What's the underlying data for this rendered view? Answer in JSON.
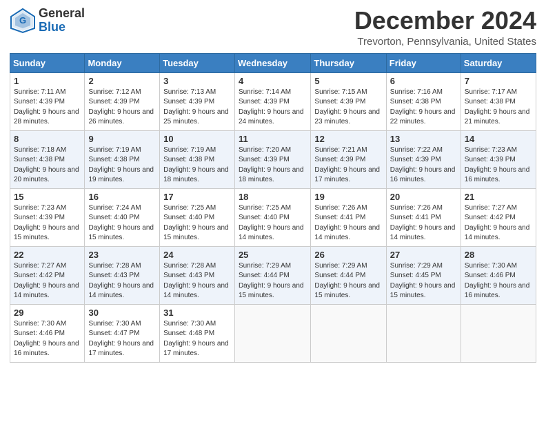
{
  "header": {
    "logo_general": "General",
    "logo_blue": "Blue",
    "month": "December 2024",
    "location": "Trevorton, Pennsylvania, United States"
  },
  "weekdays": [
    "Sunday",
    "Monday",
    "Tuesday",
    "Wednesday",
    "Thursday",
    "Friday",
    "Saturday"
  ],
  "weeks": [
    [
      {
        "day": "1",
        "sunrise": "Sunrise: 7:11 AM",
        "sunset": "Sunset: 4:39 PM",
        "daylight": "Daylight: 9 hours and 28 minutes."
      },
      {
        "day": "2",
        "sunrise": "Sunrise: 7:12 AM",
        "sunset": "Sunset: 4:39 PM",
        "daylight": "Daylight: 9 hours and 26 minutes."
      },
      {
        "day": "3",
        "sunrise": "Sunrise: 7:13 AM",
        "sunset": "Sunset: 4:39 PM",
        "daylight": "Daylight: 9 hours and 25 minutes."
      },
      {
        "day": "4",
        "sunrise": "Sunrise: 7:14 AM",
        "sunset": "Sunset: 4:39 PM",
        "daylight": "Daylight: 9 hours and 24 minutes."
      },
      {
        "day": "5",
        "sunrise": "Sunrise: 7:15 AM",
        "sunset": "Sunset: 4:39 PM",
        "daylight": "Daylight: 9 hours and 23 minutes."
      },
      {
        "day": "6",
        "sunrise": "Sunrise: 7:16 AM",
        "sunset": "Sunset: 4:38 PM",
        "daylight": "Daylight: 9 hours and 22 minutes."
      },
      {
        "day": "7",
        "sunrise": "Sunrise: 7:17 AM",
        "sunset": "Sunset: 4:38 PM",
        "daylight": "Daylight: 9 hours and 21 minutes."
      }
    ],
    [
      {
        "day": "8",
        "sunrise": "Sunrise: 7:18 AM",
        "sunset": "Sunset: 4:38 PM",
        "daylight": "Daylight: 9 hours and 20 minutes."
      },
      {
        "day": "9",
        "sunrise": "Sunrise: 7:19 AM",
        "sunset": "Sunset: 4:38 PM",
        "daylight": "Daylight: 9 hours and 19 minutes."
      },
      {
        "day": "10",
        "sunrise": "Sunrise: 7:19 AM",
        "sunset": "Sunset: 4:38 PM",
        "daylight": "Daylight: 9 hours and 18 minutes."
      },
      {
        "day": "11",
        "sunrise": "Sunrise: 7:20 AM",
        "sunset": "Sunset: 4:39 PM",
        "daylight": "Daylight: 9 hours and 18 minutes."
      },
      {
        "day": "12",
        "sunrise": "Sunrise: 7:21 AM",
        "sunset": "Sunset: 4:39 PM",
        "daylight": "Daylight: 9 hours and 17 minutes."
      },
      {
        "day": "13",
        "sunrise": "Sunrise: 7:22 AM",
        "sunset": "Sunset: 4:39 PM",
        "daylight": "Daylight: 9 hours and 16 minutes."
      },
      {
        "day": "14",
        "sunrise": "Sunrise: 7:23 AM",
        "sunset": "Sunset: 4:39 PM",
        "daylight": "Daylight: 9 hours and 16 minutes."
      }
    ],
    [
      {
        "day": "15",
        "sunrise": "Sunrise: 7:23 AM",
        "sunset": "Sunset: 4:39 PM",
        "daylight": "Daylight: 9 hours and 15 minutes."
      },
      {
        "day": "16",
        "sunrise": "Sunrise: 7:24 AM",
        "sunset": "Sunset: 4:40 PM",
        "daylight": "Daylight: 9 hours and 15 minutes."
      },
      {
        "day": "17",
        "sunrise": "Sunrise: 7:25 AM",
        "sunset": "Sunset: 4:40 PM",
        "daylight": "Daylight: 9 hours and 15 minutes."
      },
      {
        "day": "18",
        "sunrise": "Sunrise: 7:25 AM",
        "sunset": "Sunset: 4:40 PM",
        "daylight": "Daylight: 9 hours and 14 minutes."
      },
      {
        "day": "19",
        "sunrise": "Sunrise: 7:26 AM",
        "sunset": "Sunset: 4:41 PM",
        "daylight": "Daylight: 9 hours and 14 minutes."
      },
      {
        "day": "20",
        "sunrise": "Sunrise: 7:26 AM",
        "sunset": "Sunset: 4:41 PM",
        "daylight": "Daylight: 9 hours and 14 minutes."
      },
      {
        "day": "21",
        "sunrise": "Sunrise: 7:27 AM",
        "sunset": "Sunset: 4:42 PM",
        "daylight": "Daylight: 9 hours and 14 minutes."
      }
    ],
    [
      {
        "day": "22",
        "sunrise": "Sunrise: 7:27 AM",
        "sunset": "Sunset: 4:42 PM",
        "daylight": "Daylight: 9 hours and 14 minutes."
      },
      {
        "day": "23",
        "sunrise": "Sunrise: 7:28 AM",
        "sunset": "Sunset: 4:43 PM",
        "daylight": "Daylight: 9 hours and 14 minutes."
      },
      {
        "day": "24",
        "sunrise": "Sunrise: 7:28 AM",
        "sunset": "Sunset: 4:43 PM",
        "daylight": "Daylight: 9 hours and 14 minutes."
      },
      {
        "day": "25",
        "sunrise": "Sunrise: 7:29 AM",
        "sunset": "Sunset: 4:44 PM",
        "daylight": "Daylight: 9 hours and 15 minutes."
      },
      {
        "day": "26",
        "sunrise": "Sunrise: 7:29 AM",
        "sunset": "Sunset: 4:44 PM",
        "daylight": "Daylight: 9 hours and 15 minutes."
      },
      {
        "day": "27",
        "sunrise": "Sunrise: 7:29 AM",
        "sunset": "Sunset: 4:45 PM",
        "daylight": "Daylight: 9 hours and 15 minutes."
      },
      {
        "day": "28",
        "sunrise": "Sunrise: 7:30 AM",
        "sunset": "Sunset: 4:46 PM",
        "daylight": "Daylight: 9 hours and 16 minutes."
      }
    ],
    [
      {
        "day": "29",
        "sunrise": "Sunrise: 7:30 AM",
        "sunset": "Sunset: 4:46 PM",
        "daylight": "Daylight: 9 hours and 16 minutes."
      },
      {
        "day": "30",
        "sunrise": "Sunrise: 7:30 AM",
        "sunset": "Sunset: 4:47 PM",
        "daylight": "Daylight: 9 hours and 17 minutes."
      },
      {
        "day": "31",
        "sunrise": "Sunrise: 7:30 AM",
        "sunset": "Sunset: 4:48 PM",
        "daylight": "Daylight: 9 hours and 17 minutes."
      },
      null,
      null,
      null,
      null
    ]
  ]
}
